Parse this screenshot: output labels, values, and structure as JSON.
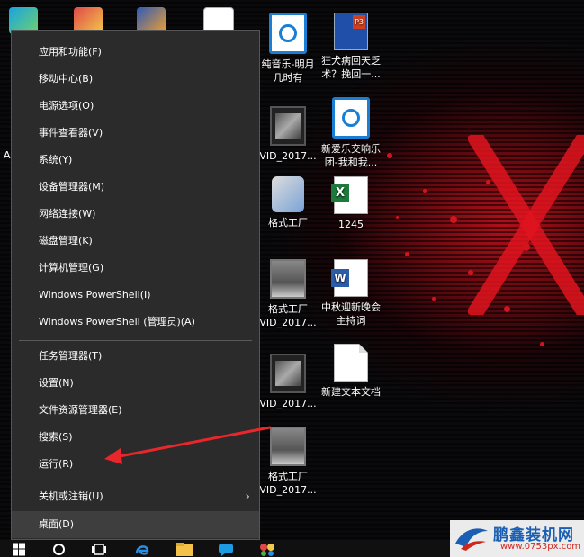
{
  "desktop": {
    "icons": [
      {
        "label": "纯音乐-明月\n几时有"
      },
      {
        "label": "狂犬病回天乏\n术？挽回一..."
      },
      {
        "label": "VID_2017..."
      },
      {
        "label": "新爱乐交响乐\n团-我和我..."
      },
      {
        "label": "格式工厂"
      },
      {
        "label": "1245"
      },
      {
        "label": "格式工厂\nVID_2017..."
      },
      {
        "label": "中秋迎新晚会\n主持词"
      },
      {
        "label": "VID_2017..."
      },
      {
        "label": "新建文本文档"
      },
      {
        "label": "格式工厂\nVID_2017..."
      }
    ],
    "left_edge_letter": "A"
  },
  "context_menu": {
    "group1": [
      {
        "label": "应用和功能(F)"
      },
      {
        "label": "移动中心(B)"
      },
      {
        "label": "电源选项(O)"
      },
      {
        "label": "事件查看器(V)"
      },
      {
        "label": "系统(Y)"
      },
      {
        "label": "设备管理器(M)"
      },
      {
        "label": "网络连接(W)"
      },
      {
        "label": "磁盘管理(K)"
      },
      {
        "label": "计算机管理(G)"
      },
      {
        "label": "Windows PowerShell(I)"
      },
      {
        "label": "Windows PowerShell (管理员)(A)"
      }
    ],
    "group2": [
      {
        "label": "任务管理器(T)"
      },
      {
        "label": "设置(N)"
      },
      {
        "label": "文件资源管理器(E)"
      },
      {
        "label": "搜索(S)"
      },
      {
        "label": "运行(R)"
      }
    ],
    "group3": [
      {
        "label": "关机或注销(U)",
        "submenu_icon": "chevron-right-icon"
      },
      {
        "label": "桌面(D)"
      }
    ],
    "highlighted_item": "运行(R)"
  },
  "taskbar": {
    "icons": [
      "start-icon",
      "cortana-circle-icon",
      "task-view-icon",
      "edge-icon",
      "file-explorer-icon",
      "chat-icon",
      "app-icon"
    ]
  },
  "annotation": {
    "arrow_color": "#e8262b",
    "points_to": "运行(R)"
  },
  "watermark": {
    "title": "鹏鑫装机网",
    "url": "www.0753px.com"
  },
  "colors": {
    "menu_bg": "#2b2b2b",
    "menu_text": "#ffffff",
    "wallpaper_accent": "#d4141c"
  }
}
